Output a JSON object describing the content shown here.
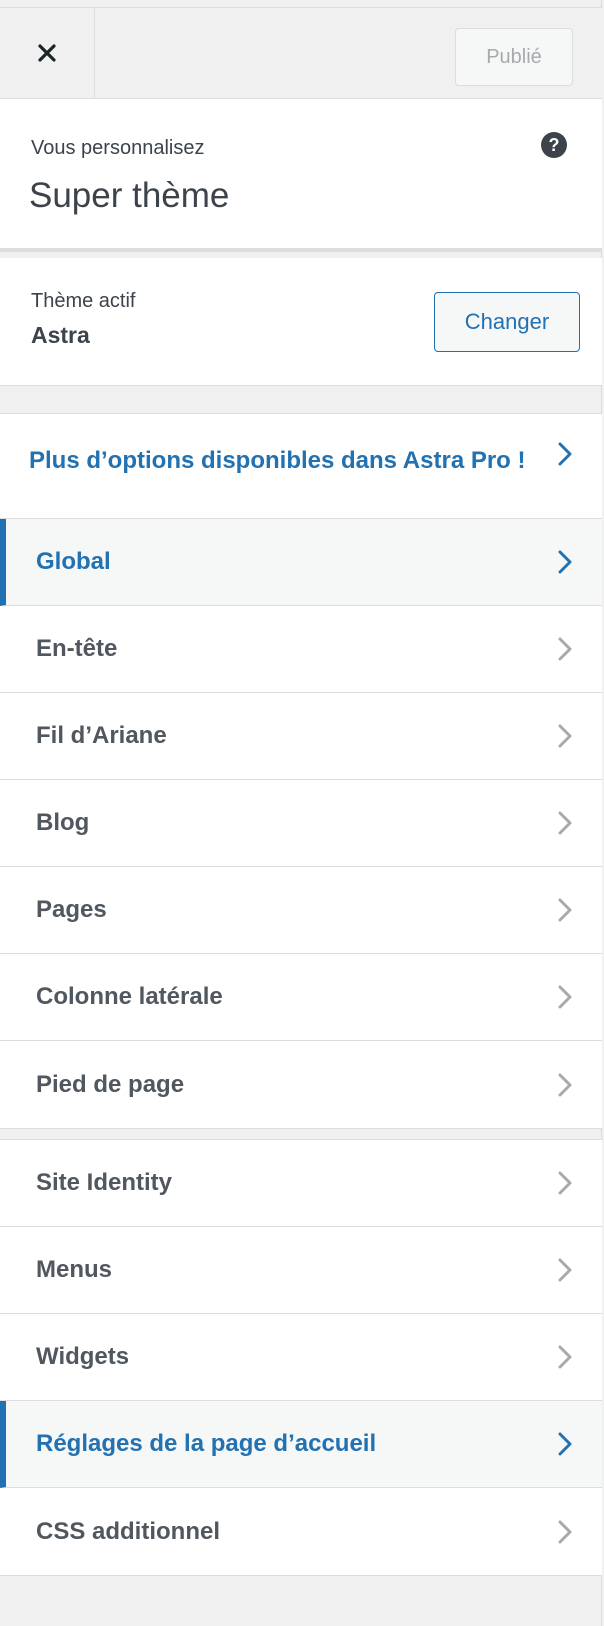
{
  "header": {
    "close_icon": "close-icon",
    "publish_label": "Publié"
  },
  "info": {
    "label": "Vous personnalisez",
    "title": "Super thème",
    "help_icon": "?"
  },
  "theme": {
    "label": "Thème actif",
    "name": "Astra",
    "change_label": "Changer"
  },
  "promo": {
    "text": "Plus d’options disponibles dans Astra Pro !"
  },
  "menu_primary": [
    {
      "label": "Global",
      "active": true
    },
    {
      "label": "En-tête",
      "active": false
    },
    {
      "label": "Fil d’Ariane",
      "active": false
    },
    {
      "label": "Blog",
      "active": false
    },
    {
      "label": "Pages",
      "active": false
    },
    {
      "label": "Colonne latérale",
      "active": false
    },
    {
      "label": "Pied de page",
      "active": false
    }
  ],
  "menu_secondary": [
    {
      "label": "Site Identity",
      "active": false
    },
    {
      "label": "Menus",
      "active": false
    },
    {
      "label": "Widgets",
      "active": false
    },
    {
      "label": "Réglages de la page d’accueil",
      "active": true
    },
    {
      "label": "CSS additionnel",
      "active": false
    }
  ],
  "colors": {
    "accent": "#2271b1",
    "text": "#50575e",
    "chevron_inactive": "#a7aaad"
  }
}
